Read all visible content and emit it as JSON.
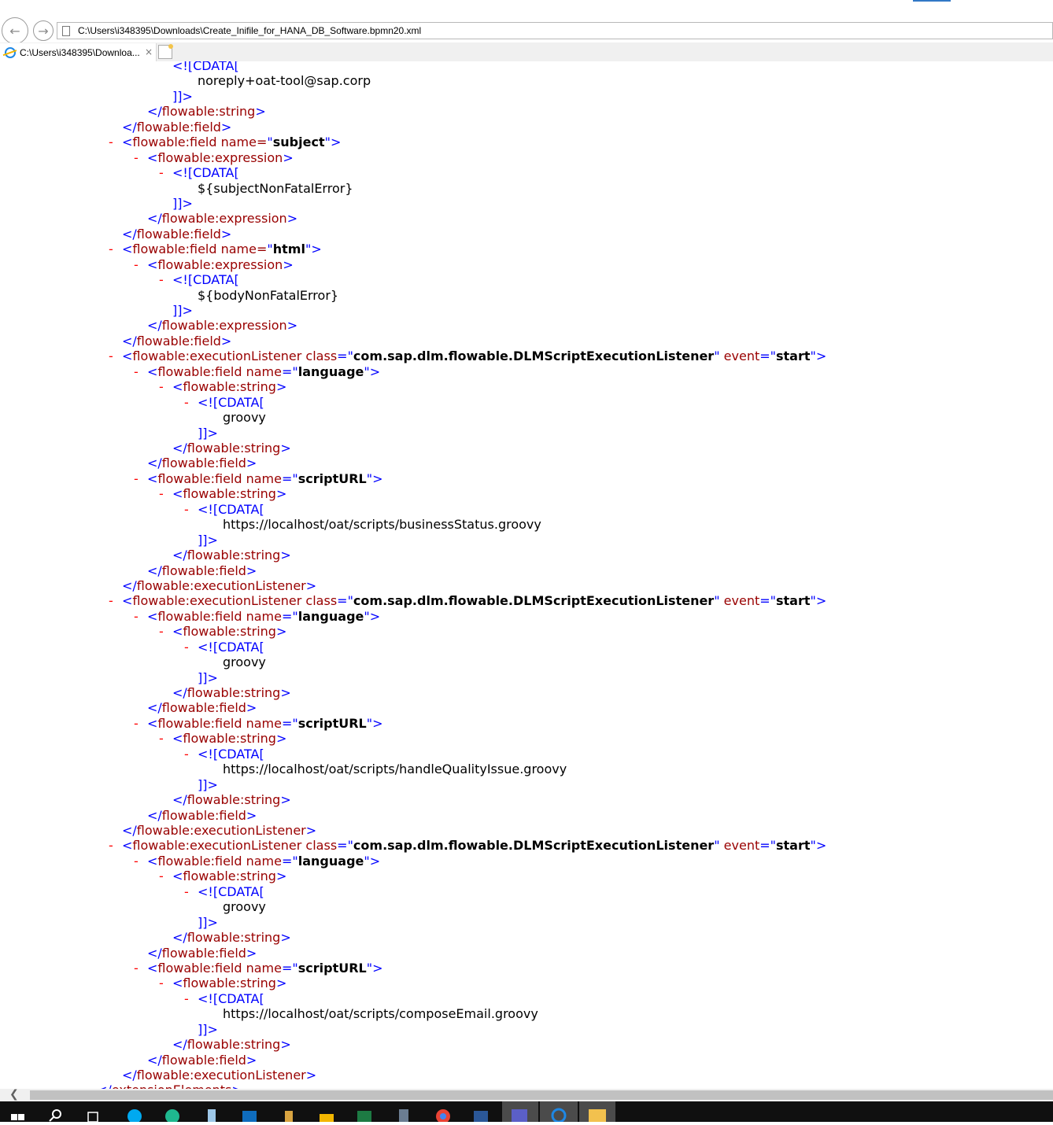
{
  "browser": {
    "url": "C:\\Users\\i348395\\Downloads\\Create_Inifile_for_HANA_DB_Software.bpmn20.xml",
    "tab_title": "C:\\Users\\i348395\\Downloa...",
    "tab_close": "×"
  },
  "icons": {
    "back": "back-arrow-icon",
    "forward": "forward-arrow-icon",
    "page": "page-icon",
    "ie": "internet-explorer-icon",
    "new_tab": "new-tab-icon"
  },
  "colors": {
    "tag": "#990000",
    "punct": "#0000ff",
    "collapse": "#ff0000",
    "text": "#000000"
  },
  "xml": {
    "lines": [
      [
        "",
        "",
        "",
        "",
        "<![CDATA[",
        ""
      ],
      [
        "",
        "",
        "",
        "",
        "",
        "noreply+oat-tool@sap.corp"
      ],
      [
        "",
        "",
        "",
        "",
        "]]>",
        ""
      ],
      [
        "",
        "</",
        "flowable:string",
        ">",
        "",
        ""
      ],
      [
        "",
        "</",
        "flowable:field",
        ">",
        "",
        ""
      ],
      [
        "-",
        "<",
        "flowable:field name=",
        "\"",
        "subject",
        "\">"
      ],
      [
        "-",
        "<",
        "flowable:expression",
        ">",
        "",
        ""
      ],
      [
        "-",
        "",
        "",
        "",
        "<![CDATA[",
        ""
      ],
      [
        "",
        "",
        "",
        "",
        "",
        "${subjectNonFatalError}"
      ],
      [
        "",
        "",
        "",
        "",
        "]]>",
        ""
      ],
      [
        "",
        "</",
        "flowable:expression",
        ">",
        "",
        ""
      ],
      [
        "",
        "</",
        "flowable:field",
        ">",
        "",
        ""
      ],
      [
        "-",
        "<",
        "flowable:field name=",
        "\"",
        "html",
        "\">"
      ],
      [
        "-",
        "<",
        "flowable:expression",
        ">",
        "",
        ""
      ],
      [
        "-",
        "",
        "",
        "",
        "<![CDATA[",
        ""
      ],
      [
        "",
        "",
        "",
        "",
        "",
        "${bodyNonFatalError}"
      ],
      [
        "",
        "",
        "",
        "",
        "]]>",
        ""
      ],
      [
        "",
        "</",
        "flowable:expression",
        ">",
        "",
        ""
      ],
      [
        "",
        "</",
        "flowable:field",
        ">",
        "",
        ""
      ]
    ],
    "listener_class": "com.sap.dlm.flowable.DLMScriptExecutionListener",
    "listener_event": "start",
    "field_language": "language",
    "field_scripturl": "scriptURL",
    "lang_value": "groovy",
    "script1": "https://localhost/oat/scripts/businessStatus.groovy",
    "script2": "https://localhost/oat/scripts/handleQualityIssue.groovy",
    "script3": "https://localhost/oat/scripts/composeEmail.groovy",
    "tokens": {
      "minus": "-",
      "lt": "<",
      "lt_close": "</",
      "gt": ">",
      "quote": "\"",
      "quote_gt": "\">",
      "eq_quote": "=\"",
      "quote_sp": "\" ",
      "cdata_open": "<![CDATA[",
      "cdata_close": "]]>",
      "exec_listener_class": "flowable:executionListener class",
      "event": "event",
      "exec_listener": "flowable:executionListener",
      "field_name": "flowable:field name",
      "field": "flowable:field",
      "string": "flowable:string",
      "extension_elements": "extensionElements"
    }
  }
}
